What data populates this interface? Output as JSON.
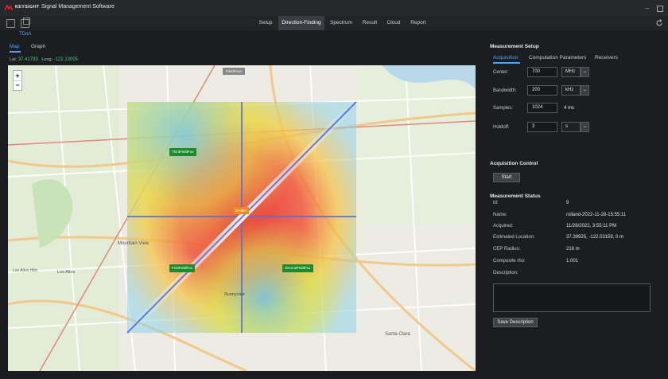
{
  "app": {
    "brand": "KEYSIGHT",
    "title": "Signal Management Software"
  },
  "nav": {
    "tabs": [
      {
        "label": "Setup"
      },
      {
        "label": "Direction-Finding"
      },
      {
        "label": "Spectrum"
      },
      {
        "label": "Result"
      },
      {
        "label": "Cloud"
      },
      {
        "label": "Report"
      }
    ],
    "active": "Direction-Finding"
  },
  "sub_tab": "TDoA",
  "map_view": {
    "tabs": [
      {
        "label": "Map"
      },
      {
        "label": "Graph"
      }
    ],
    "active": "Map",
    "lat_label": "Lat:",
    "lat_value": "37.41793",
    "long_label": "Long:",
    "long_value": "-122.13005",
    "zoom_in": "+",
    "zoom_out": "−",
    "markers": {
      "first": "FirstFieldFox",
      "second": "SecondFieldFox",
      "third": "ThirdFieldFox",
      "fourth": "FieldFox4",
      "emitter": "Emitter"
    },
    "places": {
      "mountain_view": "Mountain View",
      "los_altos": "Los Altos",
      "los_altos_hills": "Los Altos Hills",
      "sunnyvale": "Sunnyvale",
      "santa_clara": "Santa Clara"
    }
  },
  "measurement_setup": {
    "title": "Measurement Setup",
    "tabs": [
      {
        "label": "Acquisition"
      },
      {
        "label": "Computation Parameters"
      },
      {
        "label": "Receivers"
      }
    ],
    "active_tab": "Acquisition",
    "center_label": "Center:",
    "center_value": "700",
    "center_unit": "MHz",
    "bandwidth_label": "Bandwidth:",
    "bandwidth_value": "200",
    "bandwidth_unit": "kHz",
    "samples_label": "Samples:",
    "samples_value": "1024",
    "samples_time": "4 ms",
    "holdoff_label": "Holdoff:",
    "holdoff_value": "3",
    "holdoff_unit": "s"
  },
  "acquisition_control": {
    "title": "Acquisition Control",
    "start_label": "Start"
  },
  "measurement_status": {
    "title": "Measurement Status",
    "rows": [
      {
        "label": "Id:",
        "value": "9"
      },
      {
        "label": "Name:",
        "value": "rolland-2022-11-28-15:55:11"
      },
      {
        "label": "Acquired:",
        "value": "11/28/2022, 3:55:11 PM"
      },
      {
        "label": "Estimated Location:",
        "value": "37.39925, -122.03159, 0 m"
      },
      {
        "label": "CEP Radius:",
        "value": "218 m"
      },
      {
        "label": "Composite rho:",
        "value": "1.001"
      },
      {
        "label": "Description:",
        "value": ""
      }
    ],
    "save_label": "Save Description"
  },
  "icons": {
    "logo": "keysight-wave-icon",
    "toolbar_1": "panel-icon",
    "toolbar_2": "copy-icon",
    "refresh": "refresh-icon",
    "minimize": "minimize-icon",
    "maximize": "maximize-icon"
  },
  "colors": {
    "accent": "#4fa3ff",
    "coords": "#39d36a",
    "marker_green": "#1e8a2e",
    "emitter_orange": "#f08a1c",
    "brand_red": "#e8202b"
  }
}
